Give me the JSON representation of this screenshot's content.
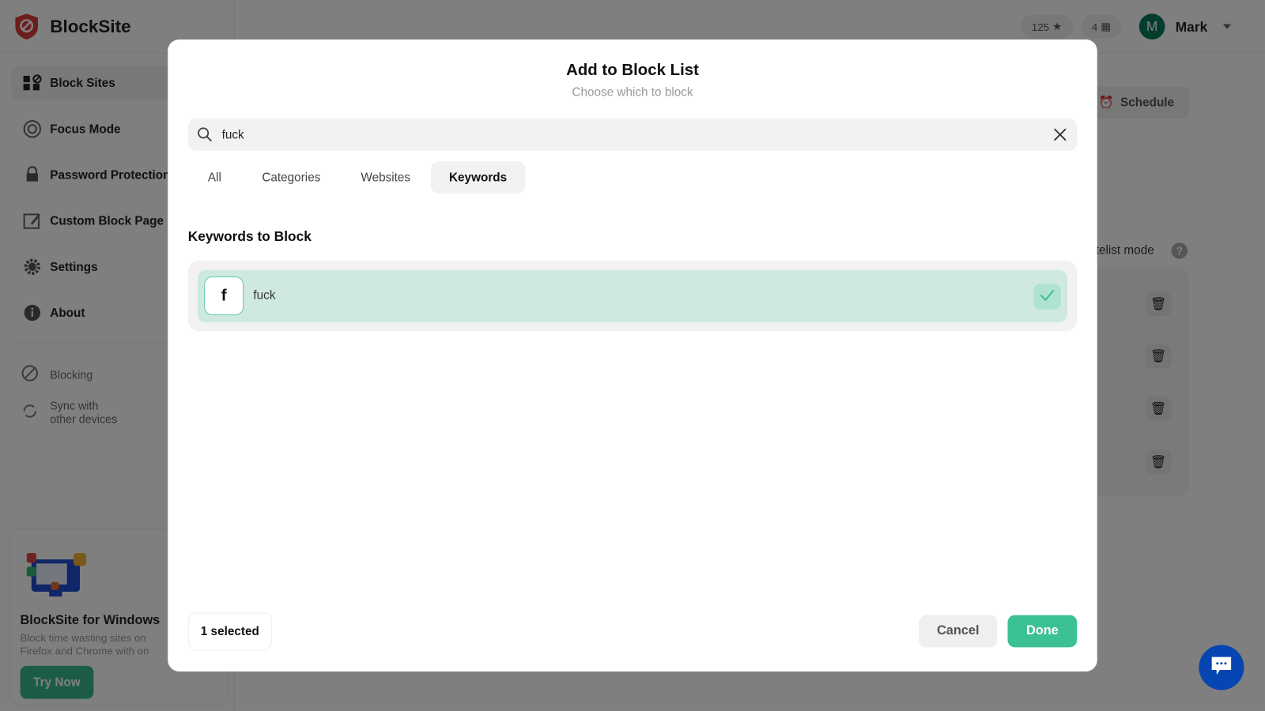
{
  "app": {
    "name": "BlockSite",
    "points": "125",
    "gifts": "4",
    "user_initial": "M",
    "user_name": "Mark",
    "brand_color": "#d93a3a"
  },
  "sidebar": {
    "items": [
      {
        "label": "Block Sites",
        "icon": "grid-block-icon"
      },
      {
        "label": "Focus Mode",
        "icon": "target-icon"
      },
      {
        "label": "Password Protection",
        "icon": "lock-icon"
      },
      {
        "label": "Custom Block Page",
        "icon": "edit-image-icon"
      },
      {
        "label": "Settings",
        "icon": "gear-icon"
      },
      {
        "label": "About",
        "icon": "info-icon"
      }
    ],
    "status": [
      {
        "label": "Blocking",
        "icon": "block-icon"
      },
      {
        "label_line1": "Sync with",
        "label_line2": "other devices",
        "icon": "sync-icon"
      }
    ],
    "promo": {
      "title": "BlockSite for Windows",
      "desc_line1": "Block time wasting sites on",
      "desc_line2": "Firefox and Chrome with on",
      "button": "Try Now"
    }
  },
  "background": {
    "schedule_label": "Schedule",
    "whitelist_label": "telist mode"
  },
  "modal": {
    "title": "Add to Block List",
    "subtitle": "Choose which to block",
    "search_value": "fuck",
    "tabs": [
      {
        "label": "All"
      },
      {
        "label": "Categories"
      },
      {
        "label": "Websites"
      },
      {
        "label": "Keywords",
        "active": true
      }
    ],
    "section_title": "Keywords to Block",
    "items": [
      {
        "initial": "f",
        "label": "fuck",
        "selected": true
      }
    ],
    "selected_count": "1 selected",
    "cancel": "Cancel",
    "done": "Done",
    "accent": "#3bc194"
  },
  "chat": {
    "icon": "chat-icon",
    "color": "#0645b2"
  }
}
